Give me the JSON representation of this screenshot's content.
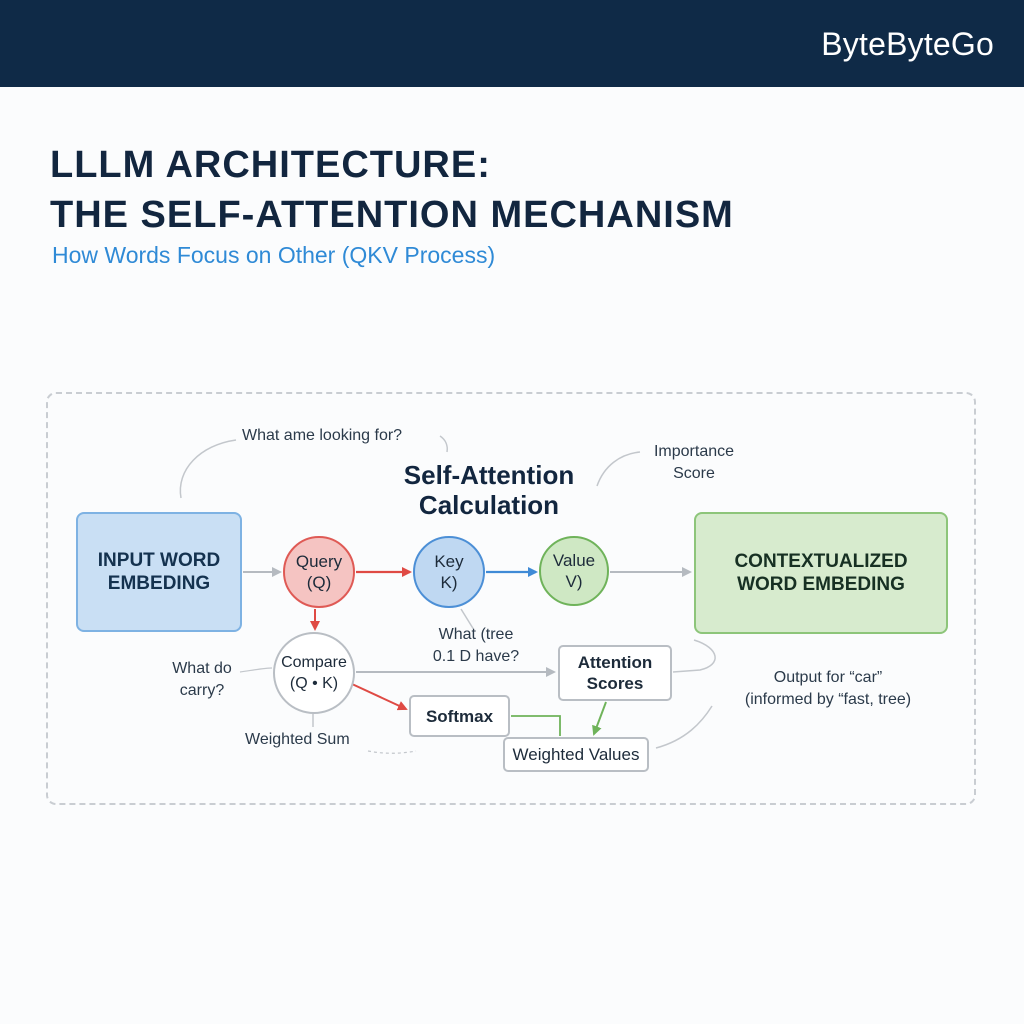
{
  "header": {
    "brand": "ByteByteGo"
  },
  "title": {
    "line1": "LLLM ARCHITECTURE:",
    "line2": "THE SELF-ATTENTION MECHANISM",
    "subtitle": "How Words Focus on Other (QKV Process)"
  },
  "diagram": {
    "center_title_1": "Self-Attention",
    "center_title_2": "Calculation",
    "input": {
      "line1": "INPUT WORD",
      "line2": "EMBEDING"
    },
    "output": {
      "line1": "CONTEXTUALIZED",
      "line2": "WORD EMBEDING"
    },
    "query": {
      "line1": "Query",
      "line2": "(Q)"
    },
    "key": {
      "line1": "Key",
      "line2": "K)"
    },
    "value": {
      "line1": "Value",
      "line2": "V)"
    },
    "compare": {
      "line1": "Compare",
      "line2": "(Q • K)"
    },
    "attention_scores": {
      "line1": "Attention",
      "line2": "Scores"
    },
    "softmax": "Softmax",
    "weighted_values": "Weighted Values",
    "notes": {
      "looking_for": "What ame looking for?",
      "importance_1": "Importance",
      "importance_2": "Score",
      "what_tree_1": "What (tree",
      "what_tree_2": "0.1 D have?",
      "carry_1": "What do",
      "carry_2": "carry?",
      "weighted_sum": "Weighted Sum",
      "output_for_1": "Output for “car”",
      "output_for_2": "(informed by “fast, tree)"
    }
  },
  "colors": {
    "header_bg": "#0f2a47",
    "title": "#12263f",
    "subtitle": "#2f8ad6",
    "query_stroke": "#df5a55",
    "key_stroke": "#4c8fd6",
    "value_stroke": "#6fb35a",
    "input_fill": "#c9dff4",
    "output_fill": "#d7ebce"
  }
}
